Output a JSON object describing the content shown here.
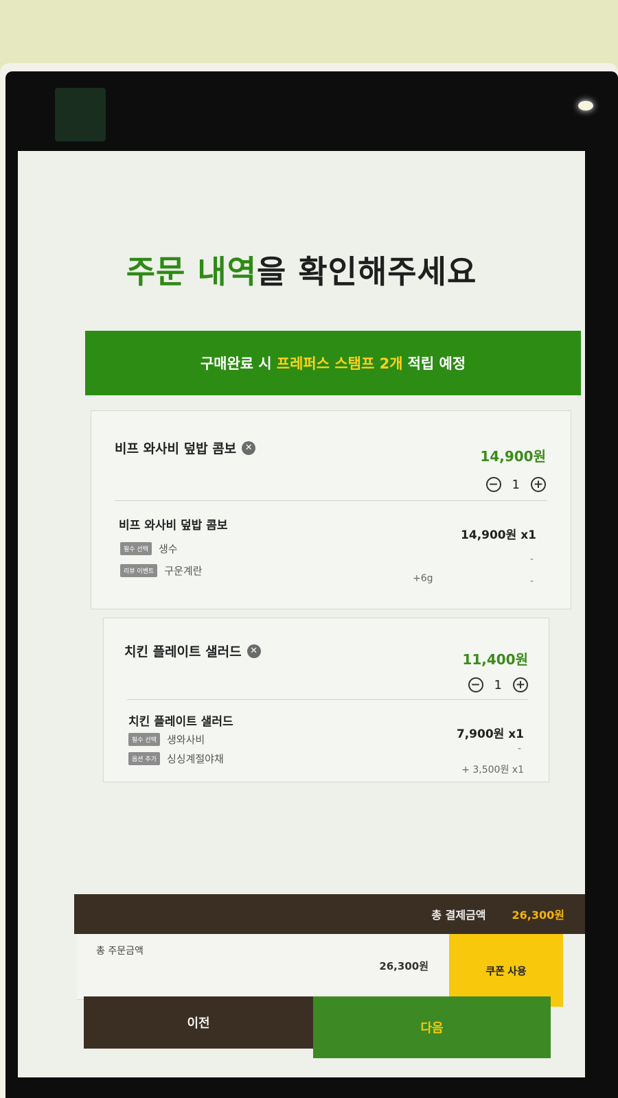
{
  "page": {
    "title_green_1": "주문",
    "title_green_2": "내역",
    "title_dark_1": "을 확인해주세요"
  },
  "banner": {
    "prefix": "구매완료 시",
    "highlight": "프레퍼스 스탬프 2개",
    "suffix": "적립 예정"
  },
  "items": [
    {
      "name": "비프 와사비 덮밥 콤보",
      "price": "14,900원",
      "qty": "1",
      "sub_name": "비프 와사비 덮밥 콤보",
      "sub_price": "14,900원 x1",
      "options": [
        {
          "tag": "필수 선택",
          "value": "생수",
          "extra": "",
          "dash": "-"
        },
        {
          "tag": "리뷰 이벤트",
          "value": "구운계란",
          "extra": "+6g",
          "dash": "-"
        }
      ]
    },
    {
      "name": "치킨 플레이트 샐러드",
      "price": "11,400원",
      "qty": "1",
      "sub_name": "치킨 플레이트 샐러드",
      "sub_price": "7,900원 x1",
      "options": [
        {
          "tag": "필수 선택",
          "value": "생와사비",
          "extra": "",
          "dash": "-"
        },
        {
          "tag": "옵션 추가",
          "value": "싱싱계절야채",
          "extra": "+ 3,500원 x1",
          "dash": ""
        }
      ]
    }
  ],
  "totals": {
    "payment_label": "총 결제금액",
    "payment_value": "26,300원",
    "order_label": "총 주문금액",
    "order_value": "26,300원"
  },
  "buttons": {
    "coupon": "쿠폰 사용",
    "prev": "이전",
    "next": "다음"
  },
  "colors": {
    "accent_green": "#2c8c14",
    "highlight_yellow": "#ffd21c",
    "coupon_yellow": "#f8c80d",
    "dark_brown": "#3b2f24"
  },
  "icons": {
    "remove": "x-circle-icon",
    "minus": "minus-circle-icon",
    "plus": "plus-circle-icon"
  }
}
